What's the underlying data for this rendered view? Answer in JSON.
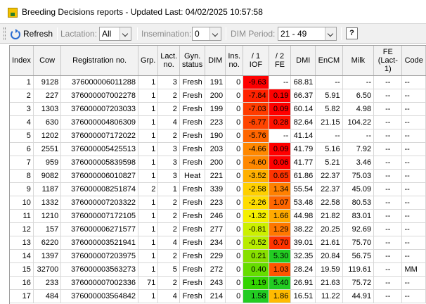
{
  "window": {
    "title": "Breeding Decisions reports - Updated Last: 04/02/2025 10:57:58"
  },
  "toolbar": {
    "refresh_label": "Refresh",
    "lactation_label": "Lactation:",
    "lactation_value": "All",
    "insemination_label": "Insemination:",
    "insemination_value": "0",
    "dim_period_label": "DIM Period:",
    "dim_period_value": "21 - 49",
    "help_label": "?"
  },
  "table": {
    "columns": [
      {
        "key": "index",
        "label": "Index",
        "top": ""
      },
      {
        "key": "cow",
        "label": "Cow",
        "top": ""
      },
      {
        "key": "registration",
        "label": "Registration no.",
        "top": ""
      },
      {
        "key": "grp",
        "label": "Grp.",
        "top": ""
      },
      {
        "key": "lact",
        "label": "Lact. no.",
        "top": ""
      },
      {
        "key": "gyn",
        "label": "Gyn. status",
        "top": ""
      },
      {
        "key": "dim",
        "label": "DIM",
        "top": ""
      },
      {
        "key": "ins",
        "label": "Ins. no.",
        "top": ""
      },
      {
        "key": "iof",
        "label": "IOF",
        "top": "/ 1"
      },
      {
        "key": "fe",
        "label": "FE",
        "top": "/ 2"
      },
      {
        "key": "dmi",
        "label": "DMI",
        "top": ""
      },
      {
        "key": "encm",
        "label": "EnCM",
        "top": ""
      },
      {
        "key": "milk",
        "label": "Milk",
        "top": ""
      },
      {
        "key": "fe_lact1",
        "label": "FE (Lact-1)",
        "top": ""
      },
      {
        "key": "code",
        "label": "Code",
        "top": ""
      }
    ],
    "rows": [
      {
        "index": "1",
        "cow": "9128",
        "registration": "376000006011288",
        "grp": "1",
        "lact": "3",
        "gyn": "Fresh",
        "dim": "191",
        "ins": "0",
        "iof": "-9.63",
        "iof_color": "#ff0000",
        "fe": "--",
        "fe_color": "#ffffff",
        "dmi": "68.81",
        "encm": "--",
        "milk": "--",
        "fe_lact1": "--",
        "code": "--"
      },
      {
        "index": "2",
        "cow": "227",
        "registration": "376000007002278",
        "grp": "1",
        "lact": "2",
        "gyn": "Fresh",
        "dim": "200",
        "ins": "0",
        "iof": "-7.84",
        "iof_color": "#ff2200",
        "fe": "0.19",
        "fe_color": "#ff0000",
        "dmi": "66.37",
        "encm": "5.91",
        "milk": "6.50",
        "fe_lact1": "--",
        "code": "--"
      },
      {
        "index": "3",
        "cow": "1303",
        "registration": "376000007203033",
        "grp": "1",
        "lact": "2",
        "gyn": "Fresh",
        "dim": "199",
        "ins": "0",
        "iof": "-7.03",
        "iof_color": "#ff3c00",
        "fe": "0.09",
        "fe_color": "#ff0000",
        "dmi": "60.14",
        "encm": "5.82",
        "milk": "4.98",
        "fe_lact1": "--",
        "code": "--"
      },
      {
        "index": "4",
        "cow": "630",
        "registration": "376000004806309",
        "grp": "1",
        "lact": "4",
        "gyn": "Fresh",
        "dim": "223",
        "ins": "0",
        "iof": "-6.77",
        "iof_color": "#ff4400",
        "fe": "0.28",
        "fe_color": "#ff1100",
        "dmi": "82.64",
        "encm": "21.15",
        "milk": "104.22",
        "fe_lact1": "--",
        "code": "--"
      },
      {
        "index": "5",
        "cow": "1202",
        "registration": "376000007172022",
        "grp": "1",
        "lact": "2",
        "gyn": "Fresh",
        "dim": "190",
        "ins": "0",
        "iof": "-5.76",
        "iof_color": "#ff6600",
        "fe": "--",
        "fe_color": "#ffffff",
        "dmi": "41.14",
        "encm": "--",
        "milk": "--",
        "fe_lact1": "--",
        "code": "--"
      },
      {
        "index": "6",
        "cow": "2551",
        "registration": "376000005425513",
        "grp": "1",
        "lact": "3",
        "gyn": "Fresh",
        "dim": "203",
        "ins": "0",
        "iof": "-4.66",
        "iof_color": "#ff8800",
        "fe": "0.09",
        "fe_color": "#ff0000",
        "dmi": "41.79",
        "encm": "5.16",
        "milk": "7.92",
        "fe_lact1": "--",
        "code": "--"
      },
      {
        "index": "7",
        "cow": "959",
        "registration": "376000005839598",
        "grp": "1",
        "lact": "3",
        "gyn": "Fresh",
        "dim": "200",
        "ins": "0",
        "iof": "-4.60",
        "iof_color": "#ff8800",
        "fe": "0.06",
        "fe_color": "#ff0000",
        "dmi": "41.77",
        "encm": "5.21",
        "milk": "3.46",
        "fe_lact1": "--",
        "code": "--"
      },
      {
        "index": "8",
        "cow": "9082",
        "registration": "376000006010827",
        "grp": "1",
        "lact": "3",
        "gyn": "Heat",
        "dim": "221",
        "ins": "0",
        "iof": "-3.52",
        "iof_color": "#ffb000",
        "fe": "0.65",
        "fe_color": "#ff3300",
        "dmi": "61.86",
        "encm": "22.37",
        "milk": "75.03",
        "fe_lact1": "--",
        "code": "--"
      },
      {
        "index": "9",
        "cow": "1187",
        "registration": "376000008251874",
        "grp": "2",
        "lact": "1",
        "gyn": "Fresh",
        "dim": "339",
        "ins": "0",
        "iof": "-2.58",
        "iof_color": "#ffd000",
        "fe": "1.34",
        "fe_color": "#ff8000",
        "dmi": "55.54",
        "encm": "22.37",
        "milk": "45.09",
        "fe_lact1": "--",
        "code": "--"
      },
      {
        "index": "10",
        "cow": "1332",
        "registration": "376000007203322",
        "grp": "1",
        "lact": "2",
        "gyn": "Fresh",
        "dim": "223",
        "ins": "0",
        "iof": "-2.26",
        "iof_color": "#ffdd00",
        "fe": "1.07",
        "fe_color": "#ff6600",
        "dmi": "53.48",
        "encm": "22.58",
        "milk": "80.53",
        "fe_lact1": "--",
        "code": "--"
      },
      {
        "index": "11",
        "cow": "1210",
        "registration": "376000007172105",
        "grp": "1",
        "lact": "2",
        "gyn": "Fresh",
        "dim": "246",
        "ins": "0",
        "iof": "-1.32",
        "iof_color": "#f5f000",
        "fe": "1.66",
        "fe_color": "#ffaa00",
        "dmi": "44.98",
        "encm": "21.82",
        "milk": "83.01",
        "fe_lact1": "--",
        "code": "--"
      },
      {
        "index": "12",
        "cow": "157",
        "registration": "376000006271577",
        "grp": "1",
        "lact": "2",
        "gyn": "Fresh",
        "dim": "277",
        "ins": "0",
        "iof": "-0.81",
        "iof_color": "#ccf000",
        "fe": "1.29",
        "fe_color": "#ff7700",
        "dmi": "38.22",
        "encm": "20.25",
        "milk": "92.69",
        "fe_lact1": "--",
        "code": "--"
      },
      {
        "index": "13",
        "cow": "6220",
        "registration": "376000003521941",
        "grp": "1",
        "lact": "4",
        "gyn": "Fresh",
        "dim": "234",
        "ins": "0",
        "iof": "-0.52",
        "iof_color": "#b8ec00",
        "fe": "0.70",
        "fe_color": "#ff3300",
        "dmi": "39.01",
        "encm": "21.61",
        "milk": "75.70",
        "fe_lact1": "--",
        "code": "--"
      },
      {
        "index": "14",
        "cow": "1397",
        "registration": "376000007203975",
        "grp": "1",
        "lact": "2",
        "gyn": "Fresh",
        "dim": "229",
        "ins": "0",
        "iof": "0.21",
        "iof_color": "#88e000",
        "fe": "5.30",
        "fe_color": "#22cc22",
        "dmi": "32.35",
        "encm": "20.84",
        "milk": "56.75",
        "fe_lact1": "--",
        "code": "--"
      },
      {
        "index": "15",
        "cow": "32700",
        "registration": "376000003563273",
        "grp": "1",
        "lact": "5",
        "gyn": "Fresh",
        "dim": "272",
        "ins": "0",
        "iof": "0.40",
        "iof_color": "#66dd00",
        "fe": "1.03",
        "fe_color": "#ff5500",
        "dmi": "28.24",
        "encm": "19.59",
        "milk": "119.61",
        "fe_lact1": "--",
        "code": "MM"
      },
      {
        "index": "16",
        "cow": "233",
        "registration": "376000007002336",
        "grp": "71",
        "lact": "2",
        "gyn": "Fresh",
        "dim": "243",
        "ins": "0",
        "iof": "1.19",
        "iof_color": "#33d400",
        "fe": "5.40",
        "fe_color": "#22cc22",
        "dmi": "26.91",
        "encm": "21.63",
        "milk": "75.72",
        "fe_lact1": "--",
        "code": "--"
      },
      {
        "index": "17",
        "cow": "484",
        "registration": "376000003564842",
        "grp": "1",
        "lact": "4",
        "gyn": "Fresh",
        "dim": "214",
        "ins": "0",
        "iof": "1.58",
        "iof_color": "#22cc22",
        "fe": "1.86",
        "fe_color": "#ffbb00",
        "dmi": "16.51",
        "encm": "11.22",
        "milk": "44.91",
        "fe_lact1": "--",
        "code": "--"
      }
    ]
  }
}
